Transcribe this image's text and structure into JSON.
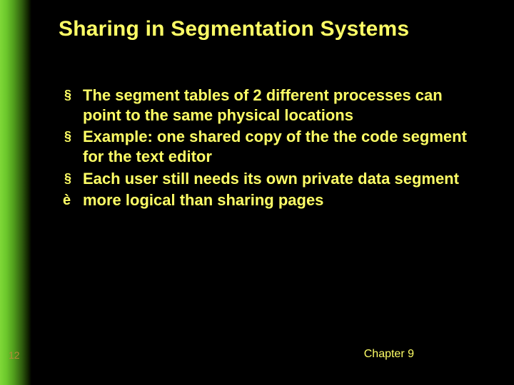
{
  "slide": {
    "title": "Sharing in Segmentation Systems",
    "bullets": [
      {
        "marker": "§",
        "text": "The segment tables of 2 different processes can point to the same physical locations"
      },
      {
        "marker": "§",
        "text": "Example: one shared copy of the the code segment for the text editor"
      },
      {
        "marker": "§",
        "text": "Each user still needs its own private data segment"
      },
      {
        "marker": "è",
        "text": "more logical than sharing pages"
      }
    ],
    "page_number": "12",
    "chapter": "Chapter 9"
  }
}
